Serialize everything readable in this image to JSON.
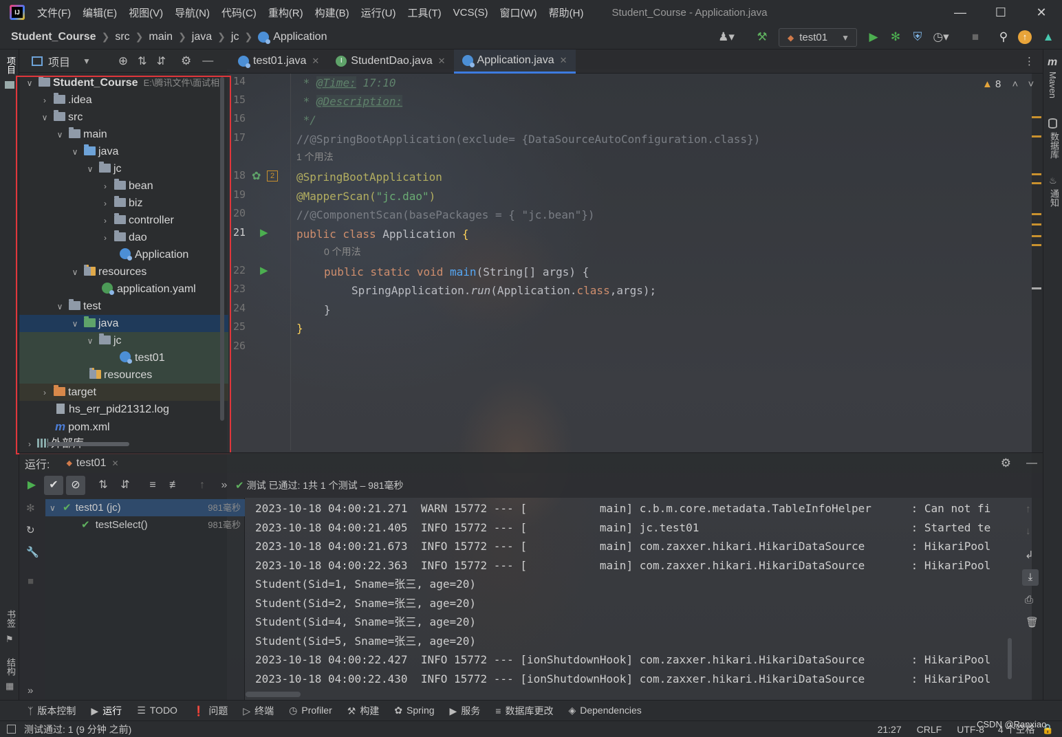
{
  "titlebar": {
    "menus": [
      "文件(F)",
      "编辑(E)",
      "视图(V)",
      "导航(N)",
      "代码(C)",
      "重构(R)",
      "构建(B)",
      "运行(U)",
      "工具(T)",
      "VCS(S)",
      "窗口(W)",
      "帮助(H)"
    ],
    "title": "Student_Course - Application.java"
  },
  "navbar": {
    "crumbs": [
      "Student_Course",
      "src",
      "main",
      "java",
      "jc",
      "Application"
    ],
    "run_config": "test01"
  },
  "left_stripe": {
    "project": "项目",
    "bookmarks": "书签",
    "structure": "结构"
  },
  "right_stripe": {
    "maven": "Maven",
    "database": "数据库",
    "notifications": "通知"
  },
  "project_panel": {
    "title": "项目",
    "root_name": "Student_Course",
    "root_path": "E:\\腾讯文件\\面试相",
    "tree": [
      ".idea",
      "src",
      "main",
      "java",
      "jc",
      "bean",
      "biz",
      "controller",
      "dao",
      "Application",
      "resources",
      "application.yaml",
      "test",
      "java",
      "jc",
      "test01",
      "resources",
      "target",
      "hs_err_pid21312.log",
      "pom.xml",
      "外部库"
    ]
  },
  "editor": {
    "tabs": [
      "test01.java",
      "StudentDao.java",
      "Application.java"
    ],
    "active_tab": "Application.java",
    "warnings": "8",
    "lines": {
      "l14": "14",
      "l15": "15",
      "l16": "16",
      "l17": "17",
      "l18": "18",
      "l19": "19",
      "l20": "20",
      "l21": "21",
      "l22": "22",
      "l23": "23",
      "l24": "24",
      "l25": "25",
      "l26": "26"
    },
    "code": {
      "c14_star": " * ",
      "c14_tag": "@Time:",
      "c14_val": " 17:10",
      "c15_star": " * ",
      "c15_tag": "@Description:",
      "c16": " */",
      "c17": "//@SpringBootApplication(exclude= {DataSourceAutoConfiguration.class})",
      "usage1": "1 个用法",
      "c18": "@SpringBootApplication",
      "c19_ann": "@MapperScan(",
      "c19_str": "\"jc.dao\"",
      "c19_end": ")",
      "c20": "//@ComponentScan(basePackages = { \"jc.bean\"})",
      "c21_kw": "public class ",
      "c21_name": "Application ",
      "c21_brace": "{",
      "usage0": "0 个用法",
      "c22_kw": "public static void ",
      "c22_fn": "main",
      "c22_rest": "(String[] args) {",
      "c23_a": "SpringApplication.",
      "c23_fn": "run",
      "c23_b": "(Application.",
      "c23_kw": "class",
      "c23_c": ",args);",
      "c24": "}",
      "c25": "}"
    },
    "gutter_badge": "2"
  },
  "run_panel": {
    "label": "运行:",
    "tab": "test01",
    "status": "测试 已通过: 1共 1 个测试 – 981毫秒",
    "tests": [
      {
        "name": "test01 (jc)",
        "duration": "981毫秒"
      },
      {
        "name": "testSelect()",
        "duration": "981毫秒"
      }
    ],
    "console": [
      "2023-10-18 04:00:21.271  WARN 15772 --- [           main] c.b.m.core.metadata.TableInfoHelper      : Can not fi",
      "2023-10-18 04:00:21.405  INFO 15772 --- [           main] jc.test01                                : Started te",
      "2023-10-18 04:00:21.673  INFO 15772 --- [           main] com.zaxxer.hikari.HikariDataSource       : HikariPool",
      "2023-10-18 04:00:22.363  INFO 15772 --- [           main] com.zaxxer.hikari.HikariDataSource       : HikariPool",
      "Student(Sid=1, Sname=张三, age=20)",
      "Student(Sid=2, Sname=张三, age=20)",
      "Student(Sid=4, Sname=张三, age=20)",
      "Student(Sid=5, Sname=张三, age=20)",
      "2023-10-18 04:00:22.427  INFO 15772 --- [ionShutdownHook] com.zaxxer.hikari.HikariDataSource       : HikariPool",
      "2023-10-18 04:00:22.430  INFO 15772 --- [ionShutdownHook] com.zaxxer.hikari.HikariDataSource       : HikariPool"
    ]
  },
  "bottom_tools": [
    "版本控制",
    "运行",
    "TODO",
    "问题",
    "终端",
    "Profiler",
    "构建",
    "Spring",
    "服务",
    "数据库更改",
    "Dependencies"
  ],
  "status_bar": {
    "message": "测试通过: 1 (9 分钟 之前)",
    "position": "21:27",
    "line_sep": "CRLF",
    "encoding": "UTF-8",
    "indent": "4 个空格",
    "watermark": "CSDN @Ranxiao"
  }
}
